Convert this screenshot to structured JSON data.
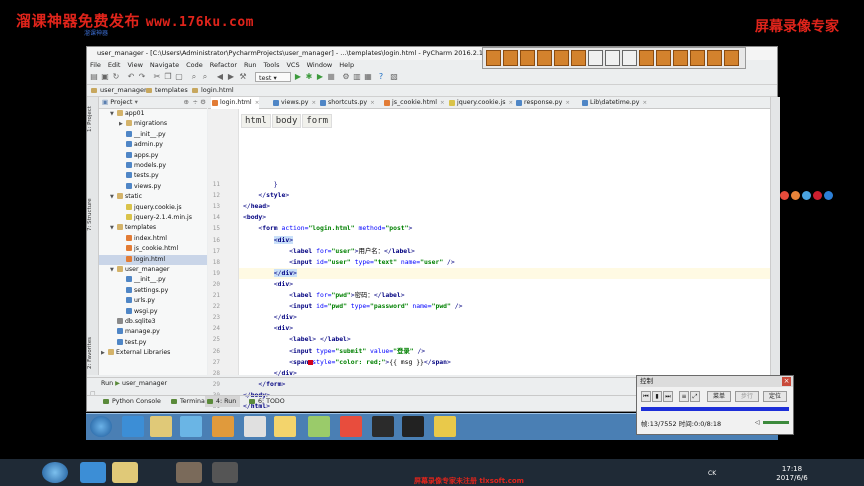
{
  "watermark": {
    "left_text": "溜课神器免费发布",
    "left_url": "www.176ku.com",
    "left_sub": "溜课神器",
    "right_text": "屏幕录像专家",
    "bottom_text": "屏幕录像专家未注册 tlxsoft.com"
  },
  "window": {
    "title": "user_manager - [C:\\Users\\Administrator\\PycharmProjects\\user_manager] - ...\\templates\\login.html - PyCharm 2016.2.1",
    "menu": [
      "File",
      "Edit",
      "View",
      "Navigate",
      "Code",
      "Refactor",
      "Run",
      "Tools",
      "VCS",
      "Window",
      "Help"
    ],
    "run_config": "test",
    "breadcrumb": [
      "user_manager",
      "templates",
      "login.html"
    ]
  },
  "project": {
    "header": "Project",
    "tree": [
      {
        "label": "app01",
        "type": "folder",
        "indent": 1,
        "open": true
      },
      {
        "label": "migrations",
        "type": "folder",
        "indent": 2,
        "open": false
      },
      {
        "label": "__init__.py",
        "type": "py",
        "indent": 2
      },
      {
        "label": "admin.py",
        "type": "py",
        "indent": 2
      },
      {
        "label": "apps.py",
        "type": "py",
        "indent": 2
      },
      {
        "label": "models.py",
        "type": "py",
        "indent": 2
      },
      {
        "label": "tests.py",
        "type": "py",
        "indent": 2
      },
      {
        "label": "views.py",
        "type": "py",
        "indent": 2
      },
      {
        "label": "static",
        "type": "folder",
        "indent": 1,
        "open": true
      },
      {
        "label": "jquery.cookie.js",
        "type": "js",
        "indent": 2
      },
      {
        "label": "jquery-2.1.4.min.js",
        "type": "js",
        "indent": 2
      },
      {
        "label": "templates",
        "type": "folder",
        "indent": 1,
        "open": true
      },
      {
        "label": "index.html",
        "type": "html",
        "indent": 2
      },
      {
        "label": "js_cookie.html",
        "type": "html",
        "indent": 2
      },
      {
        "label": "login.html",
        "type": "html",
        "indent": 2,
        "selected": true
      },
      {
        "label": "user_manager",
        "type": "folder",
        "indent": 1,
        "open": true
      },
      {
        "label": "__init__.py",
        "type": "py",
        "indent": 2
      },
      {
        "label": "settings.py",
        "type": "py",
        "indent": 2
      },
      {
        "label": "urls.py",
        "type": "py",
        "indent": 2
      },
      {
        "label": "wsgi.py",
        "type": "py",
        "indent": 2
      },
      {
        "label": "db.sqlite3",
        "type": "db",
        "indent": 1
      },
      {
        "label": "manage.py",
        "type": "py",
        "indent": 1
      },
      {
        "label": "test.py",
        "type": "py",
        "indent": 1
      },
      {
        "label": "External Libraries",
        "type": "folder",
        "indent": 0,
        "open": false
      }
    ],
    "side_tabs": [
      "1: Project",
      "7: Structure",
      "2: Favorites"
    ]
  },
  "tabs": [
    {
      "label": "login.html",
      "kind": "h",
      "active": true
    },
    {
      "label": "views.py",
      "kind": "p"
    },
    {
      "label": "shortcuts.py",
      "kind": "p"
    },
    {
      "label": "js_cookie.html",
      "kind": "h"
    },
    {
      "label": "jquery.cookie.js",
      "kind": "j"
    },
    {
      "label": "response.py",
      "kind": "p"
    },
    {
      "label": "Lib\\datetime.py",
      "kind": "p"
    }
  ],
  "editor": {
    "html_path": [
      "html",
      "body",
      "form"
    ],
    "lines": [
      {
        "n": "11",
        "html": "        }"
      },
      {
        "n": "12",
        "html": "    &lt;/<span class='tag'>style</span>&gt;"
      },
      {
        "n": "13",
        "html": "&lt;/<span class='tag'>head</span>&gt;"
      },
      {
        "n": "14",
        "html": "&lt;<span class='tag'>body</span>&gt;"
      },
      {
        "n": "15",
        "html": "    &lt;<span class='tag'>form</span> <span class='attr'>action=</span><span class='val'>\"login.html\"</span> <span class='attr'>method=</span><span class='val'>\"post\"</span>&gt;"
      },
      {
        "n": "16",
        "html": "        <span class='hl'>&lt;<span class='tag'>div</span>&gt;</span>"
      },
      {
        "n": "17",
        "html": "            &lt;<span class='tag'>label</span> <span class='attr'>for=</span><span class='val'>\"user\"</span>&gt;<span class='txt'>用户名：</span>&lt;/<span class='tag'>label</span>&gt;"
      },
      {
        "n": "18",
        "html": "            &lt;<span class='tag'>input</span> <span class='attr'>id=</span><span class='val'>\"user\"</span> <span class='attr'>type=</span><span class='val'>\"text\"</span> <span class='attr'>name=</span><span class='val'>\"user\"</span> /&gt;"
      },
      {
        "n": "19",
        "html": "        <span class='hl'>&lt;/<span class='tag'>div</span>&gt;</span>",
        "current": true
      },
      {
        "n": "20",
        "html": "        &lt;<span class='tag'>div</span>&gt;"
      },
      {
        "n": "21",
        "html": "            &lt;<span class='tag'>label</span> <span class='attr'>for=</span><span class='val'>\"pwd\"</span>&gt;<span class='txt'>密码：</span>&lt;/<span class='tag'>label</span>&gt;"
      },
      {
        "n": "22",
        "html": "            &lt;<span class='tag'>input</span> <span class='attr'>id=</span><span class='val'>\"pwd\"</span> <span class='attr'>type=</span><span class='val'>\"password\"</span> <span class='attr'>name=</span><span class='val'>\"pwd\"</span> /&gt;"
      },
      {
        "n": "23",
        "html": "        &lt;/<span class='tag'>div</span>&gt;"
      },
      {
        "n": "24",
        "html": "        &lt;<span class='tag'>div</span>&gt;"
      },
      {
        "n": "25",
        "html": "            &lt;<span class='tag'>label</span>&gt; &lt;/<span class='tag'>label</span>&gt;"
      },
      {
        "n": "26",
        "html": "            &lt;<span class='tag'>input</span> <span class='attr'>type=</span><span class='val'>\"submit\"</span> <span class='attr'>value=</span><span class='val'>\"登录\"</span> /&gt;"
      },
      {
        "n": "27",
        "html": "            &lt;<span class='tag'>span</span> <span class='attr'>style=</span><span class='val'>\"color: red;\"</span>&gt;<span class='tpl'>{{ msg }}</span>&lt;/<span class='tag'>span</span>&gt;"
      },
      {
        "n": "28",
        "html": "        &lt;/<span class='tag'>div</span>&gt;"
      },
      {
        "n": "29",
        "html": "    &lt;/<span class='tag'>form</span>&gt;"
      },
      {
        "n": "30",
        "html": "&lt;/<span class='tag'>body</span>&gt;"
      },
      {
        "n": "31",
        "html": "&lt;/<span class='tag'>html</span>&gt;"
      }
    ],
    "browser_icons": [
      "chrome-icon",
      "firefox-icon",
      "safari-icon",
      "opera-icon",
      "ie-icon"
    ]
  },
  "run_panel": {
    "label": "Run",
    "config": "user_manager"
  },
  "bottom_tabs": [
    "Python Console",
    "Terminal",
    "4: Run",
    "6: TODO"
  ],
  "control": {
    "title": "控制",
    "btn_menu": "菜单",
    "btn_step": "步行",
    "btn_locate": "定位",
    "status": "帧:13/7552 时间:0:0/8:18"
  },
  "host": {
    "clock_time": "17:18",
    "clock_date": "2017/6/6",
    "ime": "CK"
  }
}
